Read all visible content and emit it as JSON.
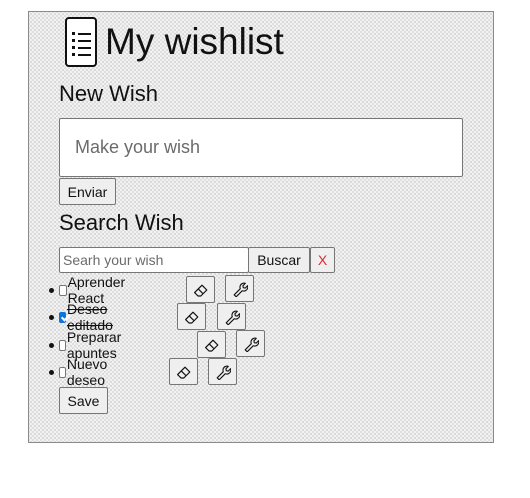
{
  "header": {
    "title": "My wishlist",
    "icon": "list-icon"
  },
  "new_wish": {
    "heading": "New Wish",
    "input_placeholder": "Make your wish",
    "submit_label": "Enviar"
  },
  "search": {
    "heading": "Search Wish",
    "input_placeholder": "Searh your wish",
    "search_label": "Buscar",
    "clear_label": "X"
  },
  "wishes": [
    {
      "text": "Aprender React",
      "done": false
    },
    {
      "text": "Deseo editado",
      "done": true
    },
    {
      "text": "Preparar apuntes",
      "done": false
    },
    {
      "text": "Nuevo deseo",
      "done": false
    }
  ],
  "wish_actions": {
    "delete_icon": "eraser-icon",
    "edit_icon": "wrench-icon"
  },
  "save_label": "Save",
  "colors": {
    "clear_button_text": "#e0292e",
    "checkbox_checked": "#0b74de"
  }
}
